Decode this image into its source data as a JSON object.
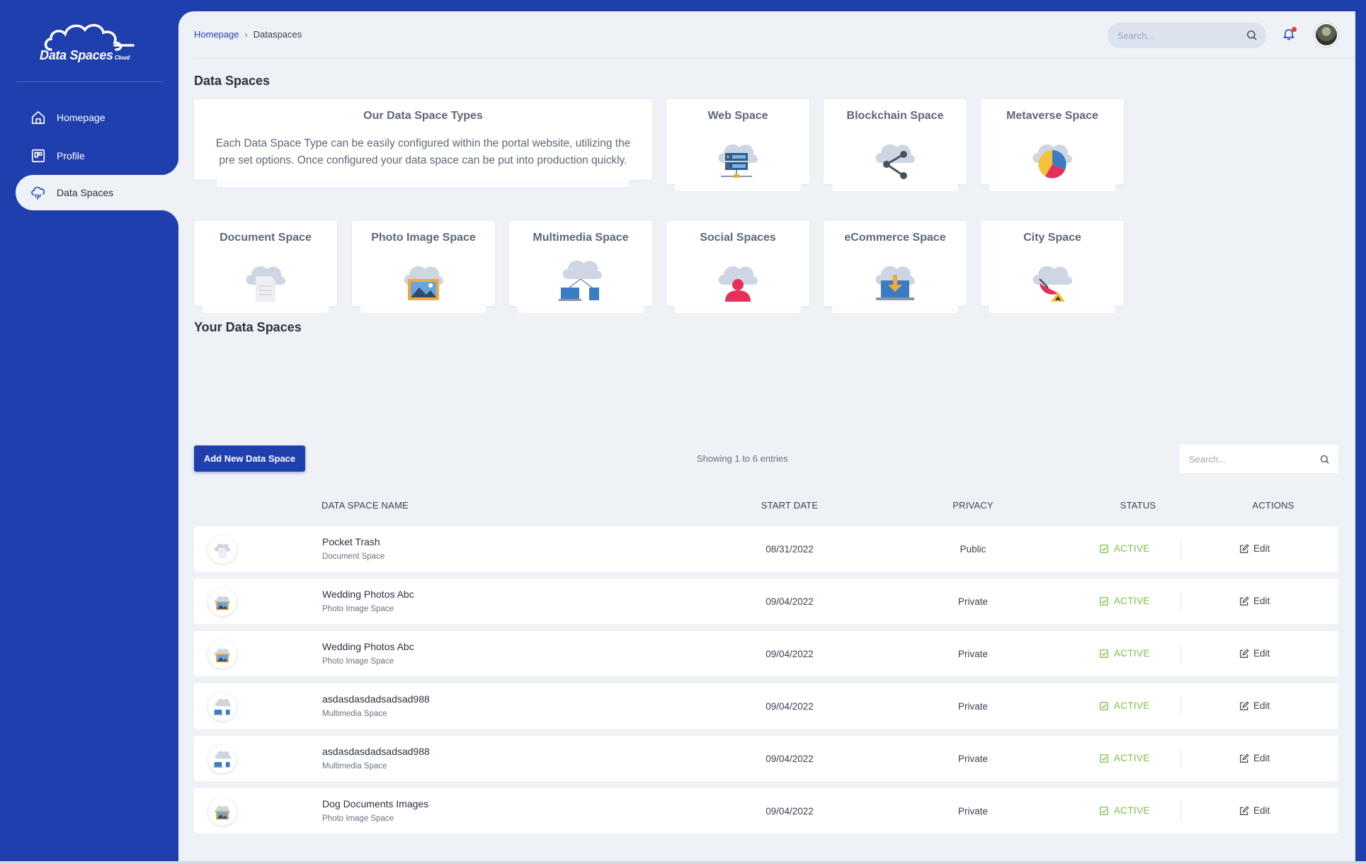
{
  "brand": {
    "name": "Data Spaces",
    "suffix": "Cloud"
  },
  "sidebar": {
    "items": [
      {
        "label": "Homepage",
        "icon": "home-icon",
        "active": false
      },
      {
        "label": "Profile",
        "icon": "profile-card-icon",
        "active": false
      },
      {
        "label": "Data Spaces",
        "icon": "cloud-rain-icon",
        "active": true
      }
    ]
  },
  "breadcrumb": {
    "home": "Homepage",
    "separator": "›",
    "current": "Dataspaces"
  },
  "topbar": {
    "search_placeholder": "Search...",
    "notifications": true
  },
  "types_section": {
    "title": "Data Spaces",
    "intro": {
      "title": "Our Data Space Types",
      "text": "Each Data Space Type can be easily configured within the portal website, utilizing the pre set options. Once configured your data space can be put into production quickly."
    },
    "types": [
      {
        "label": "Web Space",
        "icon": "cloud-server-icon"
      },
      {
        "label": "Blockchain Space",
        "icon": "cloud-share-icon"
      },
      {
        "label": "Metaverse Space",
        "icon": "cloud-pie-chart-icon"
      },
      {
        "label": "Document Space",
        "icon": "cloud-document-icon"
      },
      {
        "label": "Photo Image Space",
        "icon": "cloud-photo-icon"
      },
      {
        "label": "Multimedia Space",
        "icon": "cloud-devices-icon"
      },
      {
        "label": "Social Spaces",
        "icon": "cloud-person-icon"
      },
      {
        "label": "eCommerce Space",
        "icon": "cloud-laptop-download-icon"
      },
      {
        "label": "City Space",
        "icon": "cloud-satellite-icon"
      }
    ]
  },
  "your_spaces": {
    "title": "Your Data Spaces",
    "add_button": "Add New Data Space",
    "showing": "Showing 1 to 6 entries",
    "search_placeholder": "Search...",
    "columns": [
      "DATA SPACE NAME",
      "START DATE",
      "PRIVACY",
      "STATUS",
      "ACTIONS"
    ],
    "rows": [
      {
        "name": "Pocket Trash",
        "type": "Document Space",
        "date": "08/31/2022",
        "privacy": "Public",
        "status": "ACTIVE",
        "action": "Edit",
        "thumb": "document"
      },
      {
        "name": "Wedding Photos Abc",
        "type": "Photo Image Space",
        "date": "09/04/2022",
        "privacy": "Private",
        "status": "ACTIVE",
        "action": "Edit",
        "thumb": "photo"
      },
      {
        "name": "Wedding Photos Abc",
        "type": "Photo Image Space",
        "date": "09/04/2022",
        "privacy": "Private",
        "status": "ACTIVE",
        "action": "Edit",
        "thumb": "photo"
      },
      {
        "name": "asdasdasdadsadsad988",
        "type": "Multimedia Space",
        "date": "09/04/2022",
        "privacy": "Private",
        "status": "ACTIVE",
        "action": "Edit",
        "thumb": "multimedia"
      },
      {
        "name": "asdasdasdadsadsad988",
        "type": "Multimedia Space",
        "date": "09/04/2022",
        "privacy": "Private",
        "status": "ACTIVE",
        "action": "Edit",
        "thumb": "multimedia"
      },
      {
        "name": "Dog Documents Images",
        "type": "Photo Image Space",
        "date": "09/04/2022",
        "privacy": "Private",
        "status": "ACTIVE",
        "action": "Edit",
        "thumb": "photo"
      }
    ]
  },
  "colors": {
    "brand_blue": "#1f3fae",
    "background": "#eef1f6",
    "status_active": "#7ac142",
    "accent_red": "#e5383b"
  }
}
